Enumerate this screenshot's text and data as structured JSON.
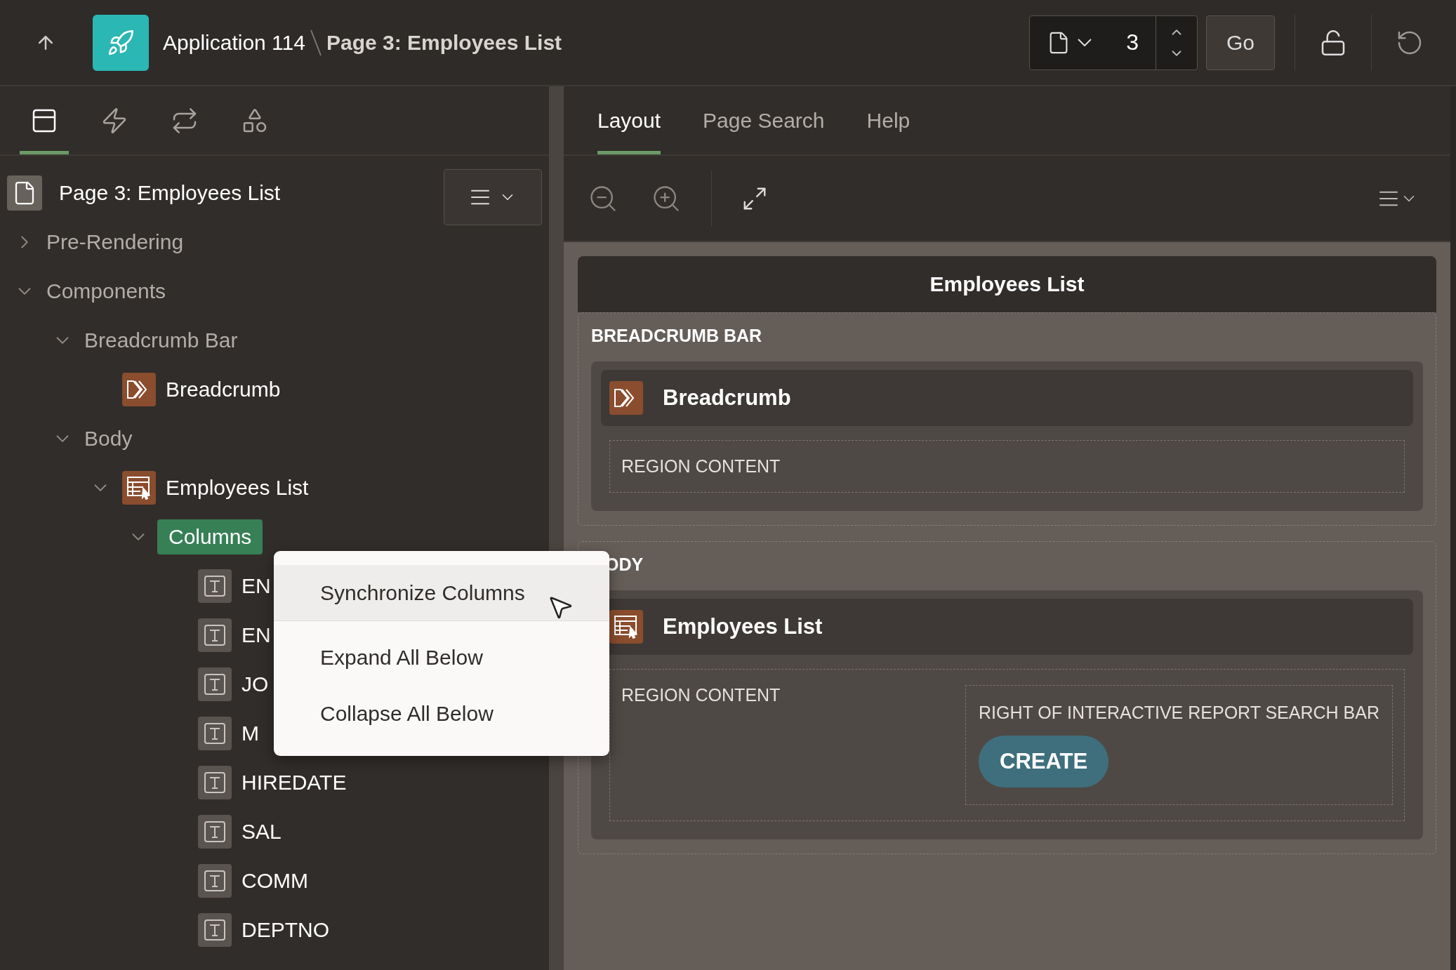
{
  "header": {
    "app": "Application 114",
    "page": "Page 3: Employees List",
    "page_number": "3",
    "go": "Go"
  },
  "left_tabs": [
    {
      "kind": "rendering",
      "selected": true
    },
    {
      "kind": "dynamic-actions",
      "selected": false
    },
    {
      "kind": "processing",
      "selected": false
    },
    {
      "kind": "shared",
      "selected": false
    }
  ],
  "tree": {
    "root": "Page 3: Employees List",
    "items": [
      {
        "label": "Pre-Rendering",
        "expanded": false,
        "selected": false
      },
      {
        "label": "Components",
        "expanded": true,
        "selected": false,
        "children": [
          {
            "label": "Breadcrumb Bar",
            "expanded": true,
            "selected": false,
            "children": [
              {
                "label": "Breadcrumb",
                "kind": "breadcrumb",
                "selected": false
              }
            ]
          },
          {
            "label": "Body",
            "expanded": true,
            "selected": false,
            "children": [
              {
                "label": "Employees List",
                "kind": "report",
                "expanded": true,
                "selected": false,
                "children": [
                  {
                    "label": "Columns",
                    "expanded": true,
                    "selected": true,
                    "children": [
                      {
                        "label": "EN",
                        "kind": "column",
                        "selected": false
                      },
                      {
                        "label": "EN",
                        "kind": "column",
                        "selected": false
                      },
                      {
                        "label": "JO",
                        "kind": "column",
                        "selected": false
                      },
                      {
                        "label": "M",
                        "kind": "column",
                        "selected": false
                      },
                      {
                        "label": "HIREDATE",
                        "kind": "column",
                        "selected": false
                      },
                      {
                        "label": "SAL",
                        "kind": "column",
                        "selected": false
                      },
                      {
                        "label": "COMM",
                        "kind": "column",
                        "selected": false
                      },
                      {
                        "label": "DEPTNO",
                        "kind": "column",
                        "selected": false
                      }
                    ]
                  }
                ]
              }
            ]
          }
        ]
      }
    ]
  },
  "context_menu": [
    {
      "label": "Synchronize Columns",
      "selected": true,
      "divider_after": true
    },
    {
      "label": "Expand All Below",
      "selected": false,
      "divider_after": false
    },
    {
      "label": "Collapse All Below",
      "selected": false,
      "divider_after": false
    }
  ],
  "right_tabs": [
    {
      "label": "Layout",
      "selected": true
    },
    {
      "label": "Page Search",
      "selected": false
    },
    {
      "label": "Help",
      "selected": false
    }
  ],
  "canvas": {
    "page_title": "Employees List",
    "regions": [
      {
        "label": "BREADCRUMB BAR",
        "component": {
          "kind": "breadcrumb",
          "title": "Breadcrumb",
          "content_label": "REGION CONTENT"
        }
      },
      {
        "label": "ODY",
        "component": {
          "kind": "report",
          "title": "Employees List",
          "content_label": "REGION CONTENT",
          "right_label": "RIGHT OF INTERACTIVE REPORT SEARCH BAR",
          "button": "CREATE"
        }
      }
    ]
  }
}
